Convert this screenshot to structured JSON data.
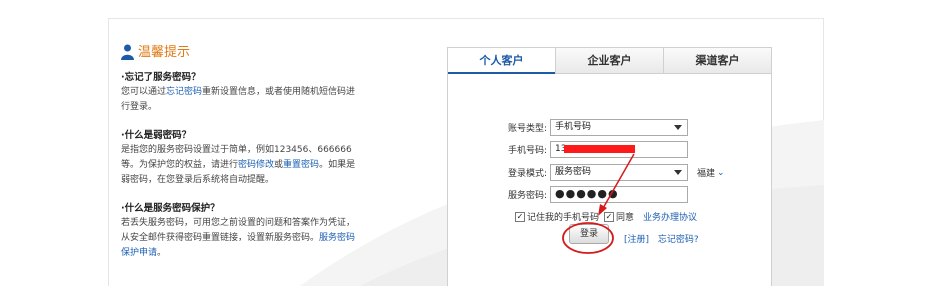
{
  "tips": {
    "title": "温馨提示",
    "blocks": [
      {
        "heading": "·忘记了服务密码？",
        "lines": [
          "您可以通过",
          "忘记密码",
          "重新设置信息，或者使用随机短信码进",
          "行登录。"
        ]
      },
      {
        "heading": "·什么是弱密码？",
        "lines": [
          "是指您的服务密码设置过于简单，例如123456、666666",
          "等。为保护您的权益，请进行",
          "密码修改",
          "或",
          "重置密码",
          "。如果是",
          "弱密码，在您登录后系统将自动提醒。"
        ]
      },
      {
        "heading": "·什么是服务密码保护？",
        "lines": [
          "若丢失服务密码，可用您之前设置的问题和答案作为凭证，",
          "从安全邮件获得密码重置链接，设置新服务密码。",
          "服务密码",
          "保护申请",
          "。"
        ]
      }
    ]
  },
  "login": {
    "tabs": [
      "个人客户",
      "企业客户",
      "渠道客户"
    ],
    "account_type_label": "账号类型:",
    "account_type_value": "手机号码",
    "phone_label": "手机号码:",
    "phone_value": "13",
    "login_mode_label": "登录模式:",
    "login_mode_value": "服务密码",
    "region": "福建",
    "password_label": "服务密码:",
    "password_mask": "●●●●●●",
    "remember_label": "记住我的手机号码",
    "agree_label": "同意",
    "agreement_link": "业务办理协议",
    "login_button": "登录",
    "register_link": "[注册]",
    "forgot_link": "忘记密码?"
  },
  "colors": {
    "accent": "#1a5fb4",
    "tip_title": "#e07a16",
    "annotation": "#d61a1a"
  }
}
